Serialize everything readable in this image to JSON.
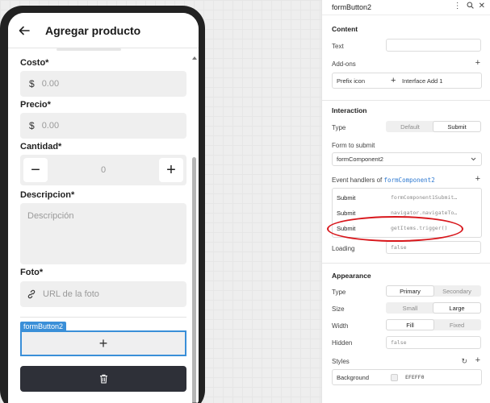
{
  "app": {
    "title": "Agregar producto",
    "fields": {
      "costo": {
        "label": "Costo*",
        "prefix": "$",
        "placeholder": "0.00"
      },
      "precio": {
        "label": "Precio*",
        "prefix": "$",
        "placeholder": "0.00"
      },
      "cantidad": {
        "label": "Cantidad*",
        "value": "0",
        "minus": "−",
        "plus": "+"
      },
      "descripcion": {
        "label": "Descripcion*",
        "placeholder": "Descripción"
      },
      "foto": {
        "label": "Foto*",
        "placeholder": "URL de la foto"
      }
    },
    "form_button_tag": "formButton2",
    "add_button_glyph": "+"
  },
  "inspector": {
    "component_name": "formButton2",
    "content": {
      "title": "Content",
      "text_label": "Text",
      "text_value": "",
      "addons_label": "Add-ons",
      "prefix_icon_label": "Prefix icon",
      "prefix_icon_value": "Interface Add 1"
    },
    "interaction": {
      "title": "Interaction",
      "type_label": "Type",
      "type_options": [
        "Default",
        "Submit"
      ],
      "type_selected": "Submit",
      "form_to_submit_label": "Form to submit",
      "form_to_submit_value": "formComponent2",
      "event_handlers_prefix": "Event handlers of",
      "event_handlers_target": "formComponent2",
      "handlers": [
        {
          "event": "Submit",
          "action": "formComponent1Submit…"
        },
        {
          "event": "Submit",
          "action": "navigator.navigateTo…"
        },
        {
          "event": "Submit",
          "action": "getItems.trigger()"
        }
      ],
      "loading_label": "Loading",
      "loading_value": "false"
    },
    "appearance": {
      "title": "Appearance",
      "type_label": "Type",
      "type_options": [
        "Primary",
        "Secondary"
      ],
      "type_selected": "Primary",
      "size_label": "Size",
      "size_options": [
        "Small",
        "Large"
      ],
      "size_selected": "Large",
      "width_label": "Width",
      "width_options": [
        "Fill",
        "Fixed"
      ],
      "width_selected": "Fill",
      "hidden_label": "Hidden",
      "hidden_value": "false",
      "styles_label": "Styles",
      "background_label": "Background",
      "background_value": "EFEFF0"
    }
  },
  "colors": {
    "accent": "#3a8fd8",
    "highlight_ellipse": "#d8161b",
    "delete_button": "#2e3038",
    "input_bg": "#EFEFF0"
  }
}
